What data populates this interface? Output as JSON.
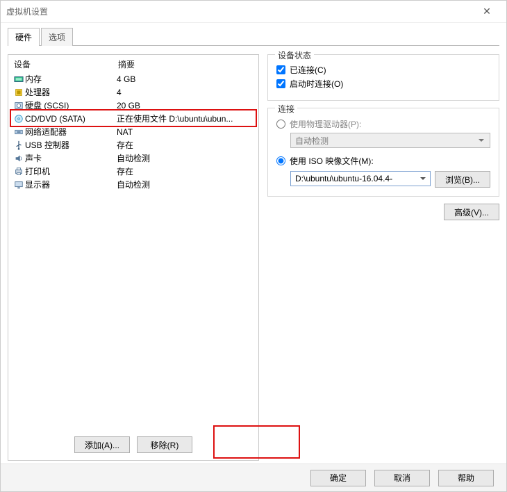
{
  "window": {
    "title": "虚拟机设置"
  },
  "tabs": {
    "hardware": "硬件",
    "options": "选项"
  },
  "listHeaders": {
    "device": "设备",
    "summary": "摘要"
  },
  "devices": [
    {
      "name": "内存",
      "summary": "4 GB",
      "icon": "memory"
    },
    {
      "name": "处理器",
      "summary": "4",
      "icon": "cpu"
    },
    {
      "name": "硬盘 (SCSI)",
      "summary": "20 GB",
      "icon": "disk"
    },
    {
      "name": "CD/DVD (SATA)",
      "summary": "正在使用文件 D:\\ubuntu\\ubun...",
      "icon": "cd"
    },
    {
      "name": "网络适配器",
      "summary": "NAT",
      "icon": "net"
    },
    {
      "name": "USB 控制器",
      "summary": "存在",
      "icon": "usb"
    },
    {
      "name": "声卡",
      "summary": "自动检测",
      "icon": "sound"
    },
    {
      "name": "打印机",
      "summary": "存在",
      "icon": "printer"
    },
    {
      "name": "显示器",
      "summary": "自动检测",
      "icon": "display"
    }
  ],
  "buttons": {
    "add": "添加(A)...",
    "remove": "移除(R)"
  },
  "status": {
    "legend": "设备状态",
    "connected": "已连接(C)",
    "connectAtBoot": "启动时连接(O)"
  },
  "connection": {
    "legend": "连接",
    "physical": "使用物理驱动器(P):",
    "autoDetect": "自动检测",
    "iso": "使用 ISO 映像文件(M):",
    "isoPath": "D:\\ubuntu\\ubuntu-16.04.4-",
    "browse": "浏览(B)..."
  },
  "advanced": "高级(V)...",
  "footer": {
    "ok": "确定",
    "cancel": "取消",
    "help": "帮助"
  }
}
